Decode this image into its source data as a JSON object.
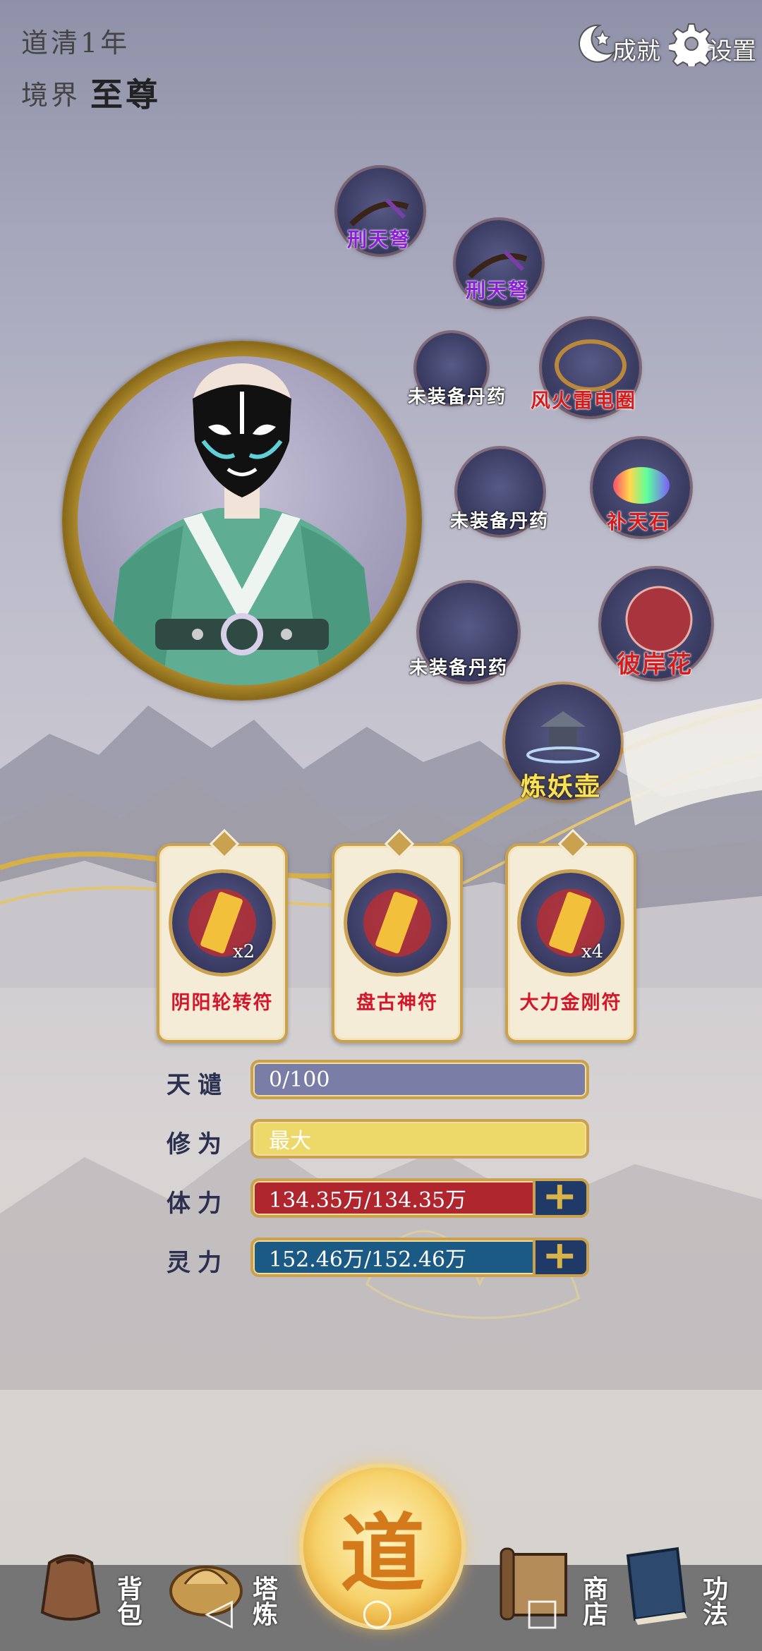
{
  "status": {
    "year_label": "道清1年",
    "realm_label": "境界",
    "realm_value": "至尊"
  },
  "top_buttons": {
    "achievements": "成就",
    "settings": "设置"
  },
  "equipment_slots": [
    {
      "label": "刑天弩",
      "style": "purple",
      "icon": "crossbow-icon"
    },
    {
      "label": "刑天弩",
      "style": "purple",
      "icon": "crossbow-icon"
    },
    {
      "label": "未装备丹药",
      "style": "white",
      "icon": "empty"
    },
    {
      "label": "风火雷电圈",
      "style": "red",
      "icon": "ring-icon"
    },
    {
      "label": "未装备丹药",
      "style": "white",
      "icon": "empty"
    },
    {
      "label": "补天石",
      "style": "red",
      "icon": "rainbow-stone-icon"
    },
    {
      "label": "未装备丹药",
      "style": "white",
      "icon": "empty"
    },
    {
      "label": "彼岸花",
      "style": "red",
      "icon": "spider-lily-icon"
    },
    {
      "label": "炼妖壶",
      "style": "yellow",
      "icon": "pagoda-cauldron-icon"
    }
  ],
  "talismans": [
    {
      "name": "阴阳轮转符",
      "count": "x2"
    },
    {
      "name": "盘古神符",
      "count": ""
    },
    {
      "name": "大力金刚符",
      "count": "x4"
    }
  ],
  "stats": {
    "tianqian": {
      "label": "天谴",
      "value": "0/100"
    },
    "xiuwei": {
      "label": "修为",
      "value": "最大"
    },
    "tili": {
      "label": "体力",
      "value": "134.35万/134.35万"
    },
    "lingli": {
      "label": "灵力",
      "value": "152.46万/152.46万"
    }
  },
  "bottom_nav": {
    "bag": "背包",
    "tower": "塔炼",
    "center": "道",
    "shop": "商店",
    "skills": "功法"
  },
  "colors": {
    "tianqian_bar": "#7a7ea6",
    "xiuwei_bar": "#ecd96a",
    "tili_bar": "#b0262e",
    "lingli_bar": "#1c5a86",
    "gold": "#c9a14f"
  }
}
